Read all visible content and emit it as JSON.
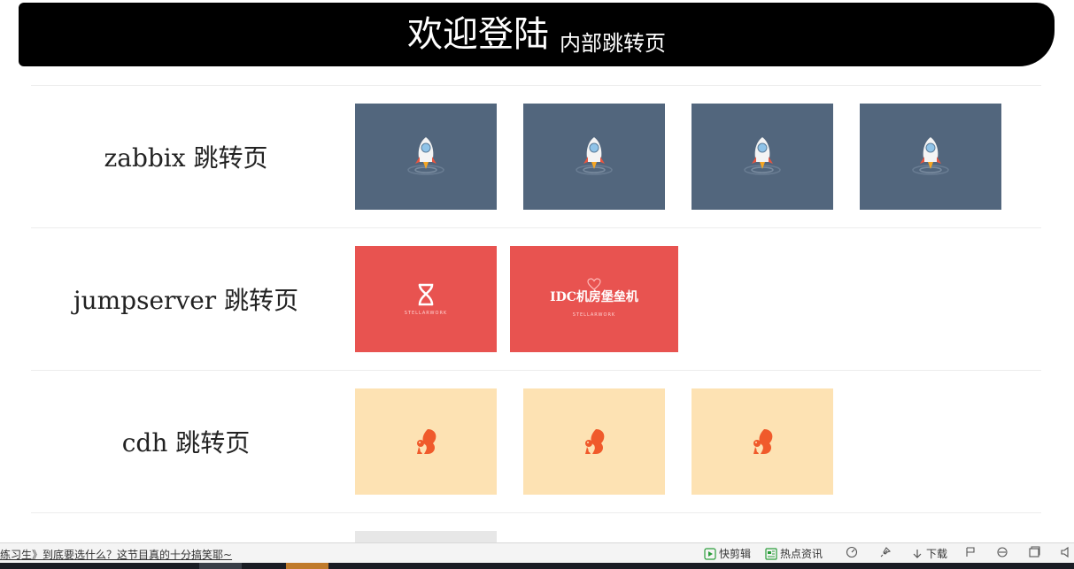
{
  "header": {
    "title": "欢迎登陆",
    "subtitle": "内部跳转页"
  },
  "rows": [
    {
      "label": "zabbix 跳转页"
    },
    {
      "label": "jumpserver 跳转页"
    },
    {
      "label": "cdh 跳转页"
    }
  ],
  "jumpserver_tiles": {
    "tile1_small": "STELLARWORK",
    "tile2_title": "IDC机房堡垒机",
    "tile2_small": "STELLARWORK"
  },
  "statusbar": {
    "news": "练习生》到底要选什么？这节目真的十分搞笑耶~",
    "quick_edit": "快剪辑",
    "hot_news": "热点资讯",
    "download": "下载"
  },
  "colors": {
    "zabbix_tile": "#52667d",
    "jumpserver_tile": "#e85350",
    "cdh_tile": "#fde2b3",
    "header_bg": "#000000"
  }
}
